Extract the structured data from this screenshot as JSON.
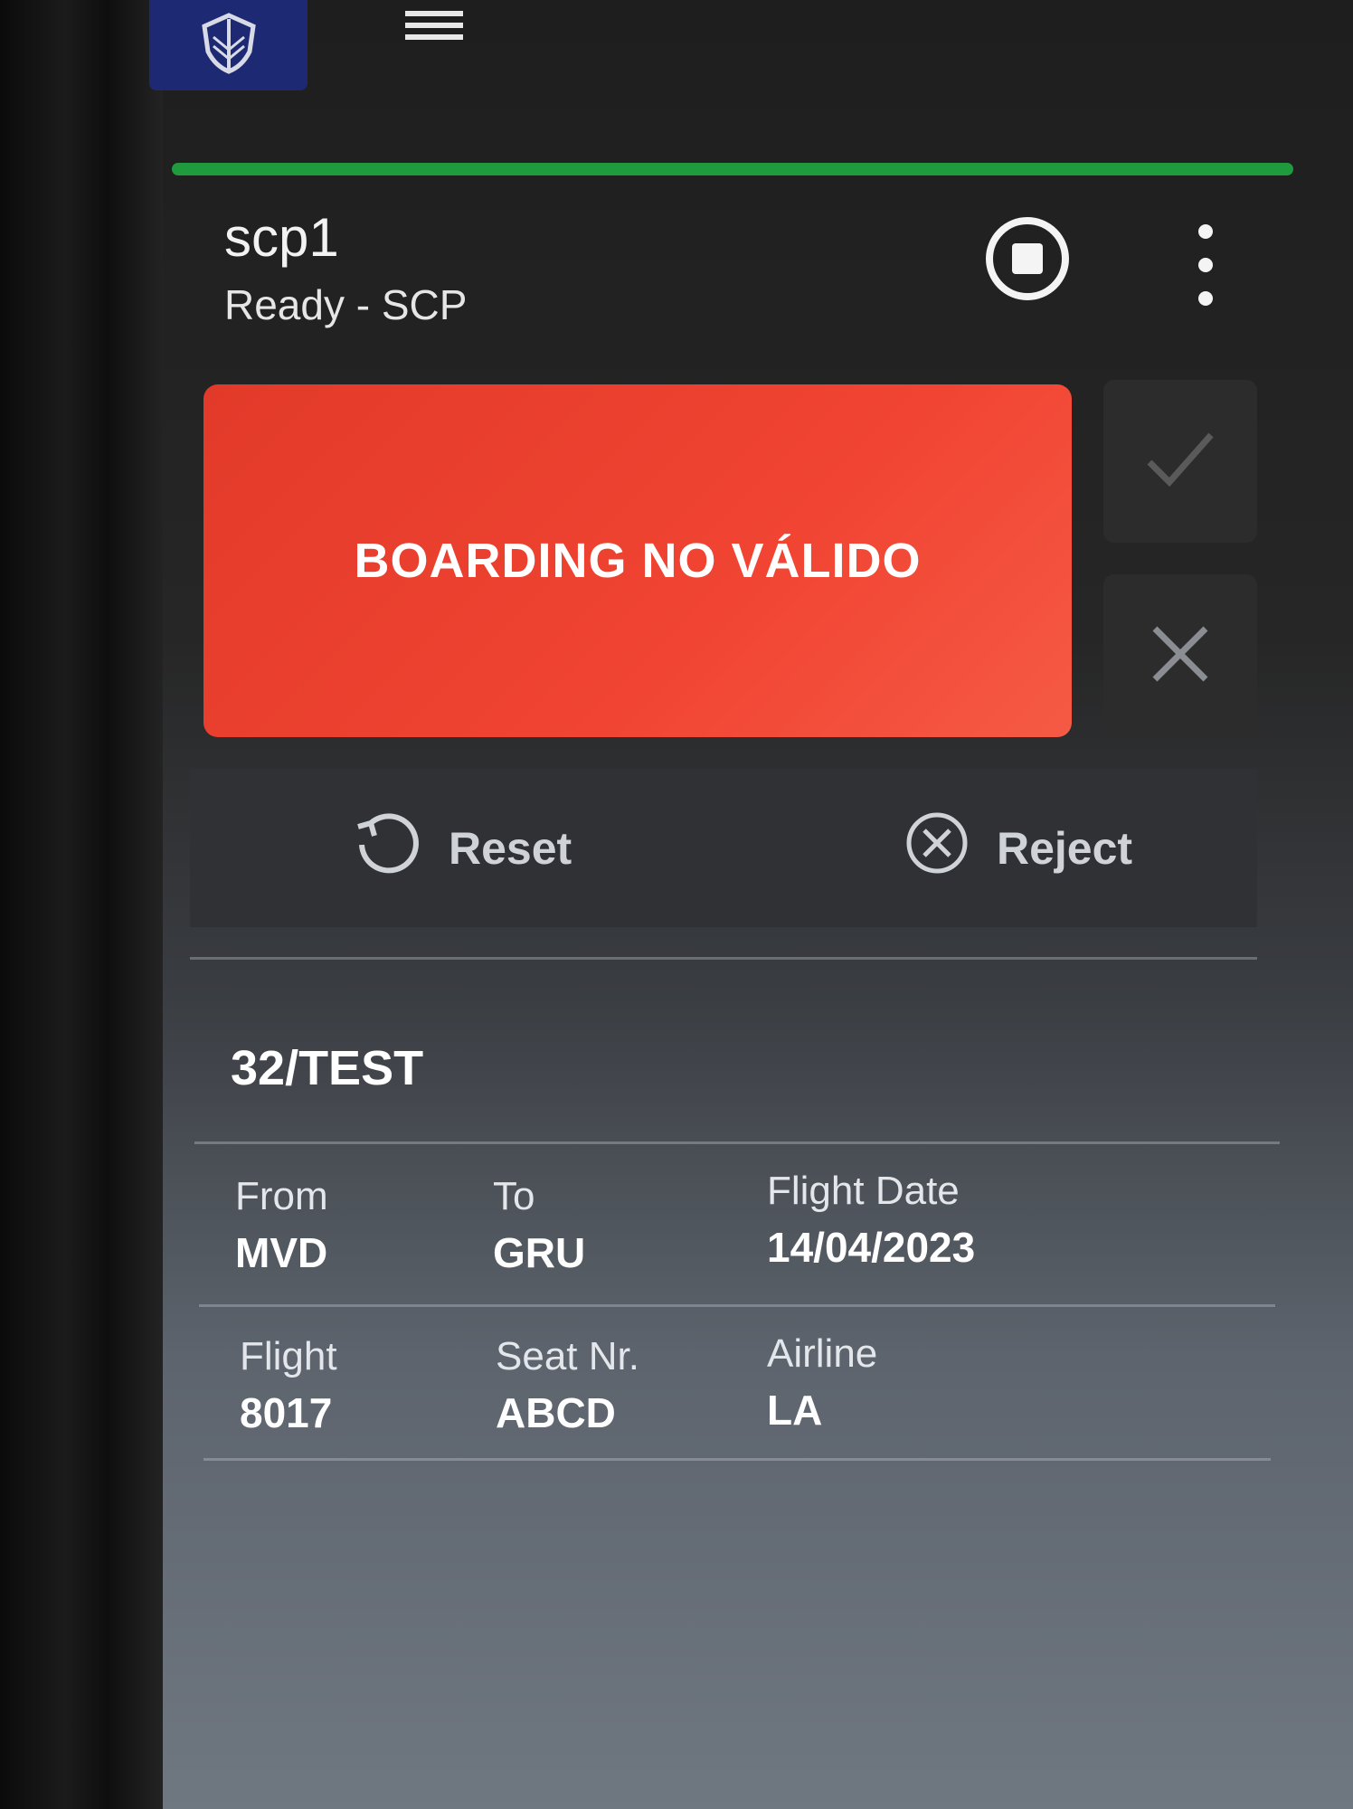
{
  "header": {
    "station_name": "scp1",
    "station_status": "Ready - SCP",
    "status_color": "#1f9a3d",
    "brand_color": "#1d2a73"
  },
  "icons": {
    "logo": "shield-logo-icon",
    "menu": "hamburger-menu-icon",
    "stop": "stop-circle-icon",
    "more": "more-vertical-icon",
    "accept": "check-icon",
    "deny": "close-icon",
    "reset": "reset-icon",
    "reject": "cancel-circle-icon"
  },
  "result": {
    "message": "BOARDING NO VÁLIDO",
    "color": "#f14432"
  },
  "actions": {
    "reset_label": "Reset",
    "reject_label": "Reject"
  },
  "passenger": {
    "name": "32/TEST",
    "fields": [
      {
        "label": "From",
        "value": "MVD"
      },
      {
        "label": "To",
        "value": "GRU"
      },
      {
        "label": "Flight Date",
        "value": "14/04/2023"
      },
      {
        "label": "Flight",
        "value": "8017"
      },
      {
        "label": "Seat Nr.",
        "value": "ABCD"
      },
      {
        "label": "Airline",
        "value": "LA"
      }
    ]
  }
}
